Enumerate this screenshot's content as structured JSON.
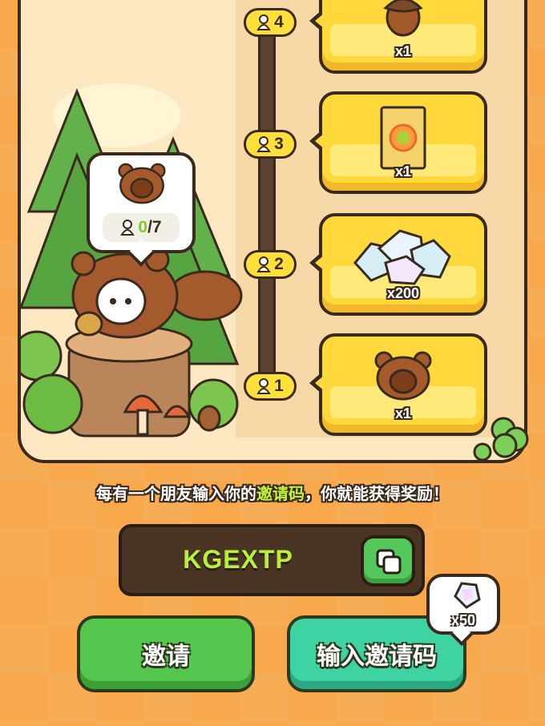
{
  "milestones": [
    {
      "level": "4",
      "reward_icon": "acorn-icon",
      "quantity": "x1"
    },
    {
      "level": "3",
      "reward_icon": "seed-packet-icon",
      "quantity": "x1"
    },
    {
      "level": "2",
      "reward_icon": "gem-pile-icon",
      "quantity": "x200"
    },
    {
      "level": "1",
      "reward_icon": "squirrel-costume-icon",
      "quantity": "x1"
    }
  ],
  "progress": {
    "current": "0",
    "total": "/7"
  },
  "info": {
    "before": "每有一个朋友输入你的",
    "highlight": "邀请码",
    "after": "，你就能获得奖励！"
  },
  "invite_code": "KGEXTP",
  "buttons": {
    "invite": "邀请",
    "enter_code": "输入邀请码"
  },
  "enter_reward": {
    "icon": "gem-icon",
    "quantity": "x50"
  },
  "colors": {
    "accent_green": "#b6f03a",
    "card_yellow": "#ffd93c",
    "panel": "#fde8c2",
    "background": "#f6a84a"
  }
}
